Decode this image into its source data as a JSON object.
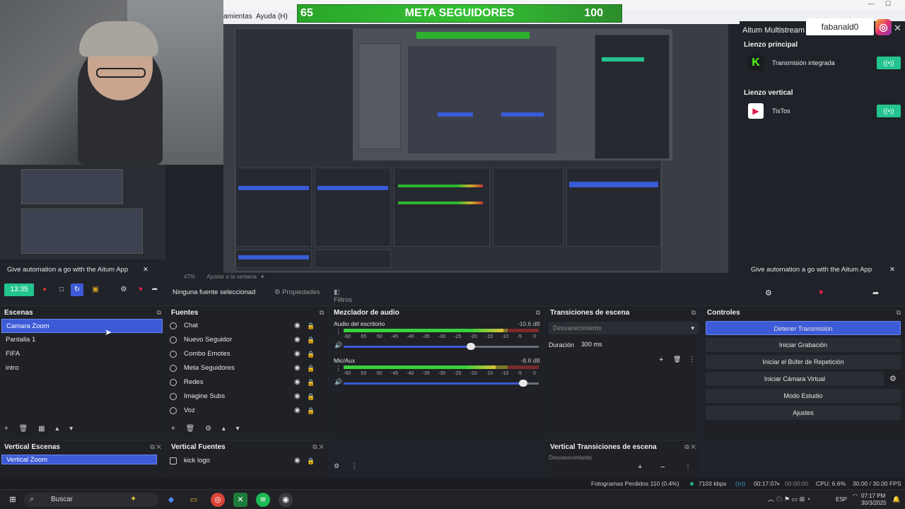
{
  "goal": {
    "current": "65",
    "title": "META SEGUIDORES",
    "target": "100"
  },
  "menu": {
    "items": [
      "amientas",
      "Ayuda (H)"
    ]
  },
  "multistream": {
    "title": "Aitum Multistream",
    "username": "fabanald0",
    "main_canvas_label": "Lienzo principal",
    "main_output": "Transmisión integrada",
    "vertical_canvas_label": "Lienzo vertical",
    "vertical_output": "TisTos",
    "automation_text": "Give automation a go with the Aitum App"
  },
  "left_automation_text": "Give automation a go with the Aitum App",
  "toolbar": {
    "timer": "13:35"
  },
  "preview_bar": {
    "zoom": "47%",
    "fit": "Ajustar a la ventana"
  },
  "source_bar": {
    "no_source": "Ninguna fuente seleccionad",
    "properties": "Propiedades",
    "filters": "Filtros"
  },
  "scenes": {
    "title": "Escenas",
    "items": [
      "Camara Zoom",
      "Pantalla 1",
      "FIFA",
      "intro"
    ]
  },
  "sources": {
    "title": "Fuentes",
    "items": [
      "Chat",
      "Nuevo Seguidor",
      "Combo Emotes",
      "Meta Seguidores",
      "Redes",
      "Imagine Subs",
      "Voz"
    ]
  },
  "mixer": {
    "title": "Mezclador de audio",
    "tracks": [
      {
        "name": "Audio del escritorio",
        "db": "-10.6 dB",
        "level": 0.82,
        "volume": 0.66
      },
      {
        "name": "Mic/Aux",
        "db": "-8.8 dB",
        "level": 0.78,
        "volume": 0.94
      }
    ],
    "scale": [
      "-60",
      "-55",
      "-50",
      "-45",
      "-40",
      "-35",
      "-30",
      "-25",
      "-20",
      "-15",
      "-10",
      "-5",
      "0"
    ]
  },
  "transitions": {
    "title": "Transiciones de escena",
    "selected": "Desvanecimiento",
    "duration_label": "Duración",
    "duration_value": "300 ms"
  },
  "controls": {
    "title": "Controles",
    "buttons": [
      "Detener Transmisión",
      "Iniciar Grabación",
      "Iniciar el Búfer de Repetición",
      "Iniciar Cámara Virtual",
      "Modo Estudio",
      "Ajustes"
    ]
  },
  "vertical": {
    "scenes_title": "Vertical Escenas",
    "scene_item": "Vertical Zoom",
    "sources_title": "Vertical Fuentes",
    "source_item": "kick logo",
    "transitions_title": "Vertical Transiciones de escena",
    "transition_item": "Desvanecimiento"
  },
  "status": {
    "dropped": "Fotogramas Perdidos 110 (0.4%)",
    "bitrate": "7103 kbps",
    "stream_time": "00:17:07",
    "rec_time": "00:00:00",
    "cpu": "CPU: 6.6%",
    "fps": "30.00 / 30.00 FPS"
  },
  "taskbar": {
    "search": "Buscar",
    "lang": "ESP",
    "time": "07:17 PM",
    "date": "30/3/2025"
  },
  "colors": {
    "accent": "#3d5bd6",
    "goal_green": "#34c234",
    "toggle_green": "#23c48f",
    "kick_green": "#53fc18",
    "tiktok_red": "#e21d48"
  }
}
